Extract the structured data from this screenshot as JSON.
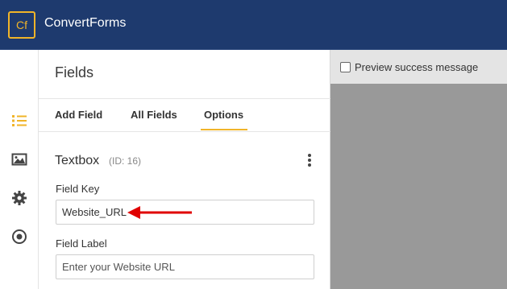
{
  "app": {
    "logo_text": "Cf",
    "brand": "ConvertForms",
    "brand_color": "#1e3a6e",
    "accent_color": "#f0b429"
  },
  "rail": {
    "icons": [
      "list-icon",
      "image-icon",
      "gear-icon",
      "target-icon"
    ],
    "active": "list-icon"
  },
  "panel": {
    "title": "Fields",
    "tabs": [
      {
        "label": "Add Field"
      },
      {
        "label": "All Fields"
      },
      {
        "label": "Options",
        "active": true
      }
    ],
    "field_type": "Textbox",
    "field_id": "(ID: 16)",
    "field_key_label": "Field Key",
    "field_key_value": "Website_URL",
    "field_label_label": "Field Label",
    "field_label_placeholder": "Enter your Website URL"
  },
  "preview": {
    "checkbox_label": "Preview success message",
    "checked": false
  },
  "annotation": {
    "arrow_color": "#e00000"
  }
}
